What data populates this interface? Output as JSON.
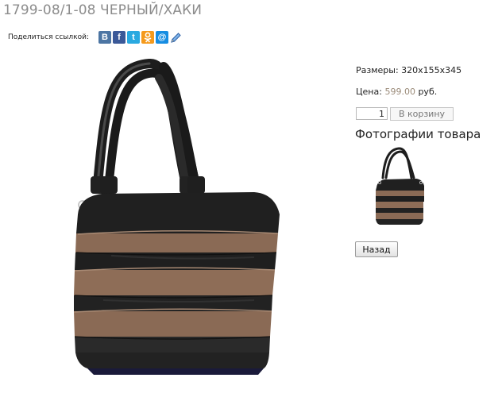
{
  "product": {
    "title": "1799-08/1-08 ЧЕРНЫЙ/ХАКИ",
    "size_label": "Размеры:",
    "size_value": "320x155x345",
    "price_label": "Цена:",
    "price_value": "599.00",
    "price_currency": "руб.",
    "quantity": "1",
    "cart_label": "В корзину",
    "photos_heading": "Фотографии товара",
    "back_label": "Назад"
  },
  "share": {
    "label": "Поделиться ссылкой:",
    "icons": [
      {
        "name": "vkontakte-icon",
        "glyph": "В",
        "color": "#4c75a3"
      },
      {
        "name": "facebook-icon",
        "glyph": "f",
        "color": "#3b5998"
      },
      {
        "name": "twitter-icon",
        "glyph": "t",
        "color": "#2aa9e0"
      },
      {
        "name": "odnoklassniki-icon",
        "glyph": "ok",
        "color": "#f59a1c"
      },
      {
        "name": "mail-ru-icon",
        "glyph": "@",
        "color": "#168de2"
      },
      {
        "name": "livejournal-pencil-icon",
        "glyph": "✎",
        "color": "#3c78c4"
      }
    ]
  },
  "colors": {
    "title": "#8c8c8c",
    "price": "#9a8a78",
    "bag_black": "#1e1e1e",
    "bag_khaki": "#8a6a55"
  }
}
